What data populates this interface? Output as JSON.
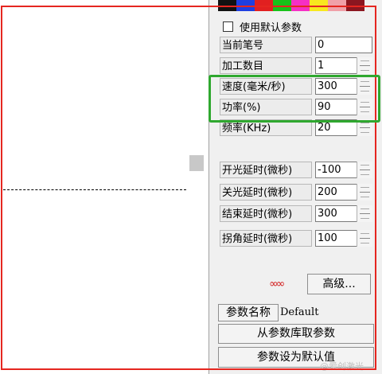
{
  "swatches": [
    "#111111",
    "#1f3fe0",
    "#e12020",
    "#18c21a",
    "#f62fc5",
    "#f8e81f",
    "#f0a0a8",
    "#8b1620"
  ],
  "use_default_label": "使用默认参数",
  "fields": [
    {
      "label": "当前笔号",
      "value": "0",
      "spinner": false
    },
    {
      "label": "加工数目",
      "value": "1",
      "spinner": true
    },
    {
      "label": "速度(毫米/秒)",
      "value": "300",
      "spinner": true
    },
    {
      "label": "功率(%)",
      "value": "90",
      "spinner": true
    },
    {
      "label": "频率(KHz)",
      "value": "20",
      "spinner": true
    },
    {
      "label": "开光延时(微秒)",
      "value": "-100",
      "spinner": true
    },
    {
      "label": "关光延时(微秒)",
      "value": "200",
      "spinner": true
    },
    {
      "label": "结束延时(微秒)",
      "value": "300",
      "spinner": true
    },
    {
      "label": "拐角延时(微秒)",
      "value": "100",
      "spinner": true
    }
  ],
  "link_icon_glyph": "∞∞",
  "advanced_button": "高级...",
  "param_name_label": "参数名称",
  "param_name_value": "Default",
  "load_button": "从参数库取参数",
  "set_default_button": "参数设为默认值",
  "watermark": "@爱创激光"
}
